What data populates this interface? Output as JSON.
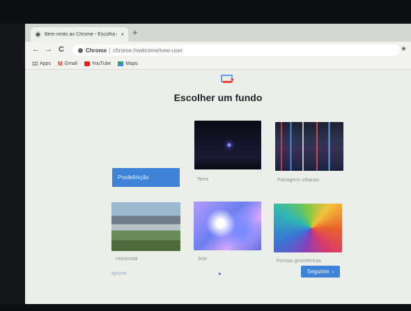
{
  "browser": {
    "tab_title": "Bem-vindo ao Chrome - Escolha um fundo",
    "tab_close": "×",
    "new_tab": "+",
    "back": "←",
    "forward": "→",
    "reload": "C",
    "site_chip": "Chrome",
    "url": "chrome://welcome/new-user",
    "bookmark_star": "★"
  },
  "bookmarks": [
    {
      "label": "Apps",
      "icon": "apps-icon"
    },
    {
      "label": "Gmail",
      "icon": "gmail-icon"
    },
    {
      "label": "YouTube",
      "icon": "youtube-icon"
    },
    {
      "label": "Maps",
      "icon": "maps-icon"
    }
  ],
  "page": {
    "title": "Escolher um fundo",
    "backgrounds": [
      {
        "label": "Predefinição",
        "selected": true
      },
      {
        "label": "Terra"
      },
      {
        "label": "Paisagens urbanas"
      },
      {
        "label": "Horizontal"
      },
      {
        "label": "Arte"
      },
      {
        "label": "Formas geométricas"
      }
    ],
    "skip_label": "Ignorar",
    "next_label": "Seguinte",
    "next_chevron": "›",
    "pager": "●"
  },
  "colors": {
    "accent": "#3f83d9"
  }
}
